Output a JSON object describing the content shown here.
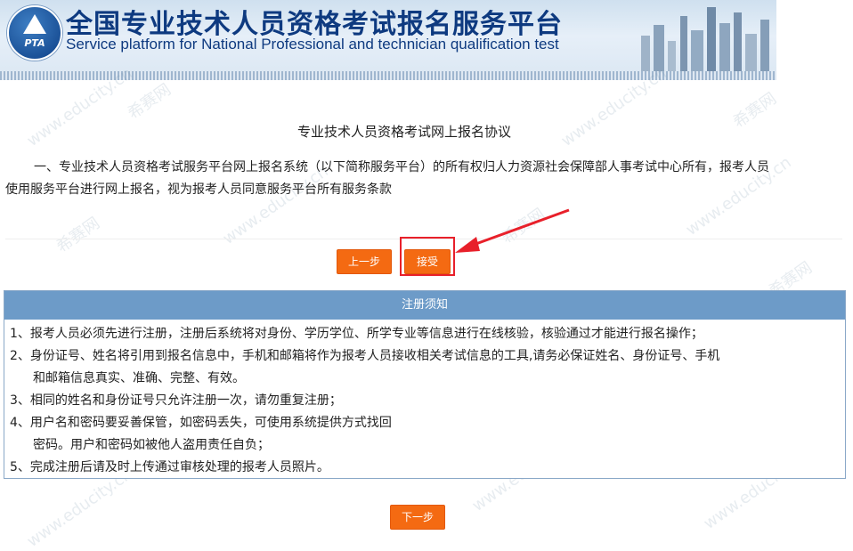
{
  "header": {
    "title_cn": "全国专业技术人员资格考试报名服务平台",
    "title_en": "Service platform for National Professional and technician  qualification test",
    "logo_text": "PTA"
  },
  "agreement": {
    "title": "专业技术人员资格考试网上报名协议",
    "paragraph": "一、专业技术人员资格考试服务平台网上报名系统（以下简称服务平台）的所有权归人力资源社会保障部人事考试中心所有，报考人员使用服务平台进行网上报名，视为报考人员同意服务平台所有服务条款"
  },
  "buttons": {
    "prev": "上一步",
    "accept": "接受",
    "next": "下一步"
  },
  "notice": {
    "heading": "注册须知",
    "lines": [
      "1、报考人员必须先进行注册，注册后系统将对身份、学历学位、所学专业等信息进行在线核验，核验通过才能进行报名操作；",
      "2、身份证号、姓名将引用到报名信息中，手机和邮箱将作为报考人员接收相关考试信息的工具,请务必保证姓名、身份证号、手机",
      "和邮箱信息真实、准确、完整、有效。",
      "3、相同的姓名和身份证号只允许注册一次，请勿重复注册；",
      "4、用户名和密码要妥善保管，如密码丢失，可使用系统提供方式找回",
      "密码。用户和密码如被他人盗用责任自负；",
      "5、完成注册后请及时上传通过审核处理的报考人员照片。"
    ]
  },
  "watermark": {
    "text_cn": "希赛网",
    "text_en": "www.educity.cn"
  },
  "colors": {
    "button": "#f46a12",
    "header_bar": "#6d9bc8",
    "highlight": "#e8202a",
    "title_blue": "#0e3a80"
  }
}
